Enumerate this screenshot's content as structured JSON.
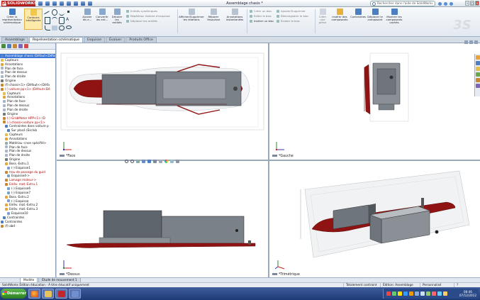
{
  "window": {
    "app_name": "SOLIDWORKS",
    "title": "Assemblage chasis *",
    "search_placeholder": "Rechercher dans l'aide de SolidWorks"
  },
  "ribbon": {
    "big_buttons": [
      {
        "label": "Créer la représentation schématique",
        "color": "#3d7cc9"
      },
      {
        "label": "Contours intelligents",
        "color": "#f3c84a"
      },
      {
        "label": "Ajuster les e...",
        "color": "#8aa7cc"
      },
      {
        "label": "Convertir les ent...",
        "color": "#8aa7cc"
      },
      {
        "label": "Décaler les entités",
        "color": "#8aa7cc"
      },
      {
        "label": "Afficher/Supprimer les relations",
        "color": "#b7c3d1"
      },
      {
        "label": "Réparer l'esquisse",
        "color": "#b7c3d1"
      },
      {
        "label": "Annotations instantanées",
        "color": "#b7c3d1"
      },
      {
        "label": "Créer un bloc",
        "color": "#b7c3d1"
      },
      {
        "label": "Insérer des composants",
        "color": "#e7b23a"
      },
      {
        "label": "Contraintes",
        "color": "#4b7fc2"
      },
      {
        "label": "Déplacer le composant",
        "color": "#4b7fc2"
      },
      {
        "label": "Montrer les composants cachés",
        "color": "#4b7fc2"
      }
    ],
    "small_items": [
      "Entités symétriques",
      "Répétition linéaire d'esquisse",
      "Déplacer les entités",
      "Créer un bloc",
      "Éditer le bloc",
      "Insérer un bloc",
      "Ajouter/Supprimer",
      "Réenregistrer le bloc",
      "Éclater le bloc",
      "Créer une pièce"
    ]
  },
  "doc_tabs": [
    "Assemblage",
    "Représentation schématique",
    "Esquisse",
    "Évaluer",
    "Produits Office"
  ],
  "active_doc_tab": 1,
  "tree": [
    {
      "label": "Assemblage chasis (Défaut<Défaut",
      "type": "root",
      "sel": true
    },
    {
      "label": "Capteurs",
      "type": "folder"
    },
    {
      "label": "Annotations",
      "type": "annot"
    },
    {
      "label": "Plan de face",
      "type": "plane"
    },
    {
      "label": "Plan de dessus",
      "type": "plane"
    },
    {
      "label": "Plan de droite",
      "type": "plane"
    },
    {
      "label": "Origine",
      "type": "origin"
    },
    {
      "label": "(f) chassi<1> (Défaut<<Défa",
      "type": "part"
    },
    {
      "label": "(-) voiture pp<1> (Défaut<Dé",
      "type": "warn"
    },
    {
      "label": "Capteurs",
      "type": "folder"
    },
    {
      "label": "Annotations",
      "type": "annot"
    },
    {
      "label": "Plan de face",
      "type": "plane"
    },
    {
      "label": "Plan de dessus",
      "type": "plane"
    },
    {
      "label": "Plan de droite",
      "type": "plane"
    },
    {
      "label": "Origine",
      "type": "origin"
    },
    {
      "label": "(-) GrabMotor HPP<1> (D",
      "type": "warn"
    },
    {
      "label": "(-) chassi<voiture pp<1>",
      "type": "warn"
    },
    {
      "label": "Contraintes dans voiture p",
      "type": "mate"
    },
    {
      "label": "Sur placé (Esclvb",
      "type": "mate"
    },
    {
      "label": "Capteurs",
      "type": "folder"
    },
    {
      "label": "Annotations",
      "type": "annot"
    },
    {
      "label": "Matériau <non spécifié>",
      "type": "material"
    },
    {
      "label": "Plan de face",
      "type": "plane"
    },
    {
      "label": "Plan de dessus",
      "type": "plane"
    },
    {
      "label": "Plan de droite",
      "type": "plane"
    },
    {
      "label": "Origine",
      "type": "origin"
    },
    {
      "label": "Boss.-Extru.1",
      "type": "feature"
    },
    {
      "label": "(-) Esquisse1",
      "type": "sketch"
    },
    {
      "label": "trou de passage du guid",
      "type": "warn"
    },
    {
      "label": "Esquisse4->",
      "type": "sketch"
    },
    {
      "label": "Lamage moteur->",
      "type": "warn"
    },
    {
      "label": "Enlèv. mat.-Extru.1",
      "type": "warn"
    },
    {
      "label": "(-) Esquisse6",
      "type": "sketch"
    },
    {
      "label": "(-) Esquisse7",
      "type": "sketch"
    },
    {
      "label": "Boss.-Extru.2",
      "type": "feature"
    },
    {
      "label": "(-) Esquisse",
      "type": "sketch"
    },
    {
      "label": "Enlèv. mat.-Extru.2",
      "type": "feature"
    },
    {
      "label": "Enlèv. mat.-Extru.3",
      "type": "feature"
    },
    {
      "label": "Esquisse10",
      "type": "sketch"
    },
    {
      "label": "Contraintes",
      "type": "mate"
    },
    {
      "label": "Contraintes",
      "type": "mate"
    },
    {
      "label": "(f) abd",
      "type": "part"
    }
  ],
  "viewports": {
    "top_left": "*Face",
    "top_right": "*Gauche",
    "bottom_left": "*Dessus",
    "bottom_right": "*Trimétrique"
  },
  "model_tabs": [
    "Modèle",
    "Étude de mouvement 1"
  ],
  "status": {
    "left": "SolidWorks Édition éducation - À titre éducatif uniquement",
    "constraint": "Totalement contraint",
    "editing": "Édition: Assemblage",
    "custom": "Personnalisé"
  },
  "taskbar": {
    "start": "Démarrer",
    "time": "08:46",
    "date": "07/12/2012"
  },
  "colors": {
    "red_part": "#8f1313",
    "gray_part": "#6f757c",
    "accent": "#3875d6"
  }
}
